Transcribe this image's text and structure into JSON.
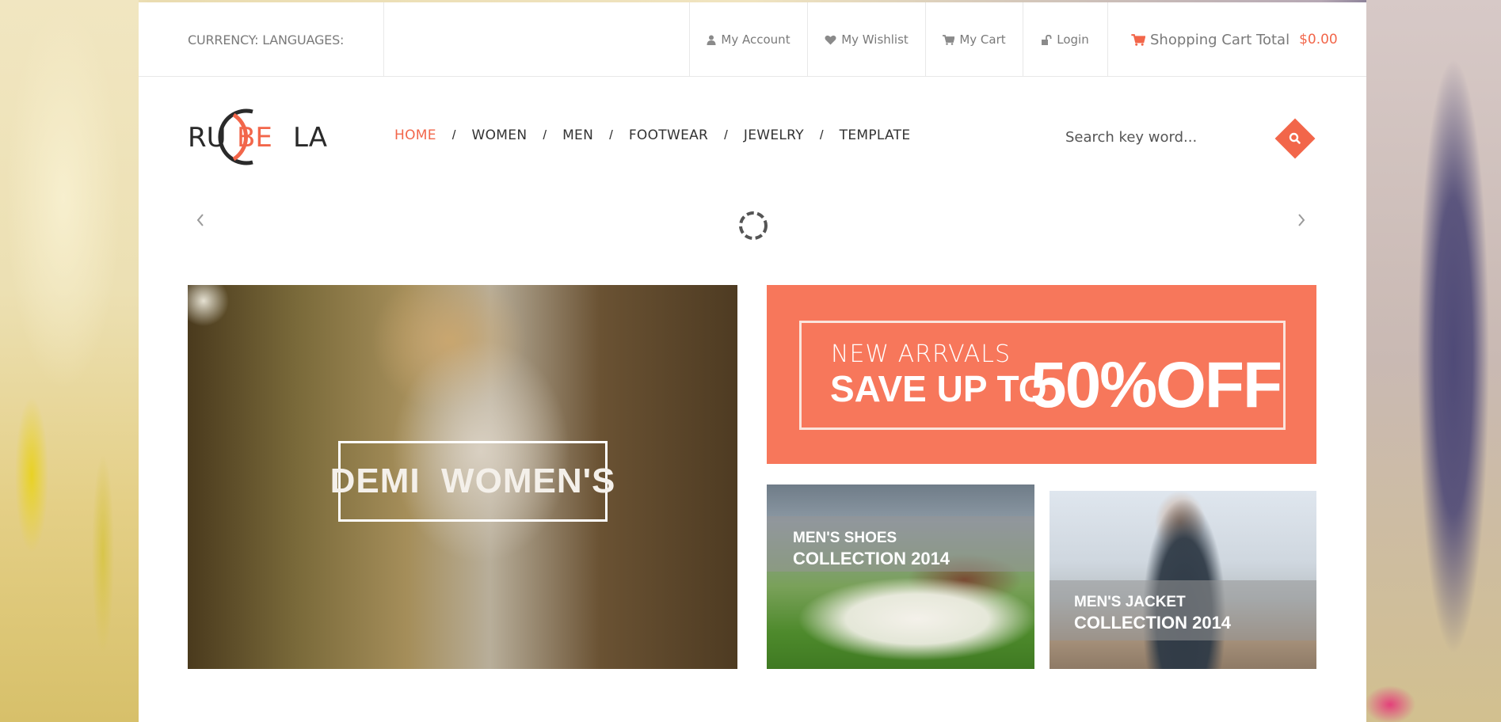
{
  "topbar": {
    "currency_label": "CURRENCY: LANGUAGES:",
    "links": {
      "account": "My Account",
      "wishlist": "My Wishlist",
      "cart": "My Cart",
      "login": "Login"
    },
    "cart_total_label": "Shopping Cart Total",
    "cart_total_amount": "$0.00"
  },
  "logo": {
    "left": "RU",
    "middle": "BE",
    "right": "LA"
  },
  "nav": {
    "items": [
      "HOME",
      "WOMEN",
      "MEN",
      "FOOTWEAR",
      "JEWELRY",
      "TEMPLATE"
    ],
    "active": "HOME",
    "separator": "/"
  },
  "search": {
    "placeholder": "Search key word..."
  },
  "banners": {
    "main_caption": "DEMI  WOMEN'S",
    "sale_sub": "NEW ARRVALS",
    "sale_main": "SAVE UP TO",
    "sale_pct": "50%OFF",
    "shoes_line1": "MEN'S SHOES",
    "shoes_line2": "COLLECTION 2014",
    "jacket_line1": "MEN'S JACKET",
    "jacket_line2": "COLLECTION 2014"
  },
  "colors": {
    "accent": "#f2664a",
    "sale_bg": "#f7775b"
  },
  "icons": {
    "account": "user-icon",
    "wishlist": "heart-icon",
    "cart": "cart-icon",
    "login": "unlock-icon",
    "search": "search-icon",
    "slider_prev": "chevron-left-icon",
    "slider_next": "chevron-right-icon",
    "loader": "spinner-icon"
  }
}
